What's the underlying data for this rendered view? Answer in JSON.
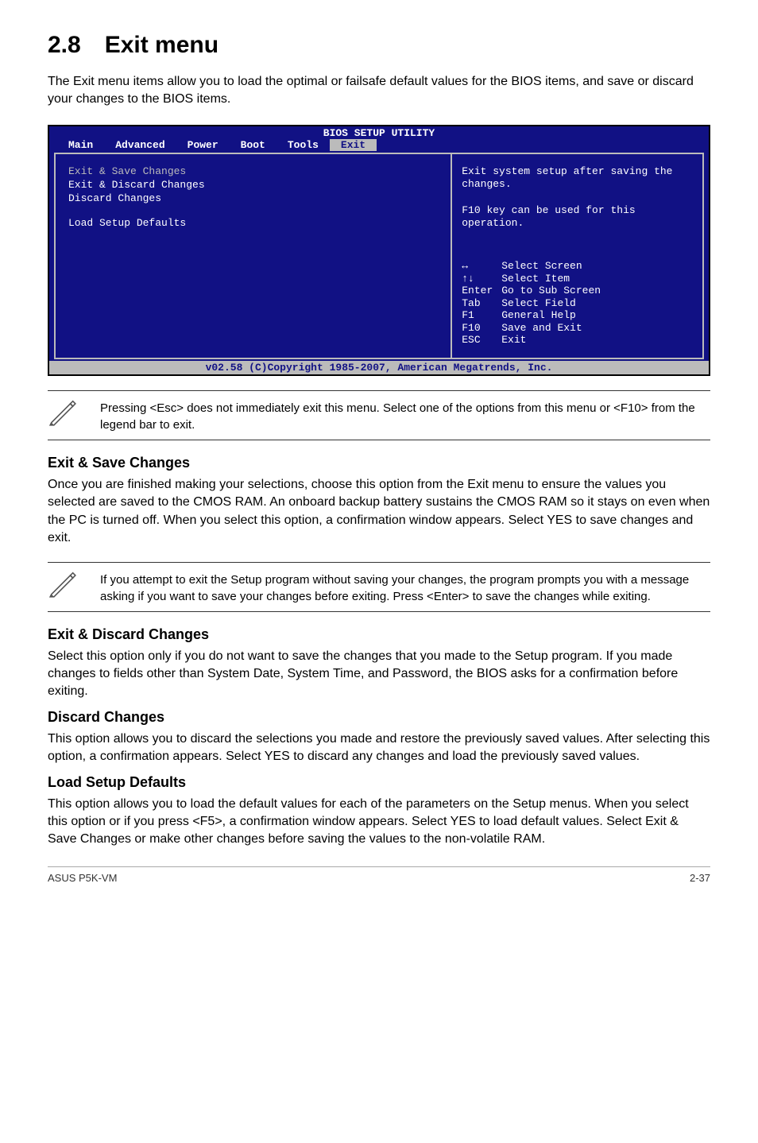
{
  "title": "2.8 Exit menu",
  "intro": "The Exit menu items allow you to load the optimal or failsafe default values for the BIOS items, and save or discard your changes to the BIOS items.",
  "bios": {
    "title": "BIOS SETUP UTILITY",
    "menus": [
      "Main",
      "Advanced",
      "Power",
      "Boot",
      "Tools",
      "Exit"
    ],
    "active_menu": "Exit",
    "left_items": [
      {
        "label": "Exit & Save Changes",
        "hl": true
      },
      {
        "label": "Exit & Discard Changes",
        "hl": false
      },
      {
        "label": "Discard Changes",
        "hl": false
      },
      {
        "label": "Load Setup Defaults",
        "hl": false,
        "gap_before": true
      }
    ],
    "help_top": "Exit system setup after saving the changes.\n\nF10 key can be used for this operation.",
    "nav": [
      {
        "key_glyph": "↔",
        "desc": "Select Screen",
        "special": true
      },
      {
        "key_glyph": "↑↓",
        "desc": "Select Item",
        "special": true
      },
      {
        "key": "Enter",
        "desc": "Go to Sub Screen"
      },
      {
        "key": "Tab",
        "desc": "Select Field"
      },
      {
        "key": "F1",
        "desc": "General Help"
      },
      {
        "key": "F10",
        "desc": "Save and Exit"
      },
      {
        "key": "ESC",
        "desc": "Exit"
      }
    ],
    "footer": "v02.58 (C)Copyright 1985-2007, American Megatrends, Inc."
  },
  "note1": "Pressing <Esc> does not immediately exit this menu. Select one of the options from this menu or <F10> from the legend bar to exit.",
  "sections": {
    "s1_title": "Exit & Save Changes",
    "s1_body": "Once you are finished making your selections, choose this option from the Exit menu to ensure the values you selected are saved to the CMOS RAM. An onboard backup battery sustains the CMOS RAM so it stays on even when the PC is turned off. When you select this option, a confirmation window appears. Select YES to save changes and exit.",
    "note2": " If you attempt to exit the Setup program without saving your changes, the program prompts you with a message asking if you want to save your changes before exiting. Press <Enter>  to save the  changes while exiting.",
    "s2_title": "Exit & Discard Changes",
    "s2_body": "Select this option only if you do not want to save the changes that you  made to the Setup program. If you made changes to fields other than System Date, System Time, and Password, the BIOS asks for a confirmation before exiting.",
    "s3_title": "Discard Changes",
    "s3_body": "This option allows you to discard the selections you made and restore the previously saved values. After selecting this option, a confirmation appears. Select YES to discard any changes and load the previously saved values.",
    "s4_title": "Load Setup Defaults",
    "s4_body": "This option allows you to load the default values for each of the parameters on the Setup menus. When you select this option or if you press <F5>, a confirmation window appears. Select YES to load default values. Select Exit & Save Changes or make other changes before saving the values to the non-volatile RAM."
  },
  "footer_left": "ASUS P5K-VM",
  "footer_right": "2-37"
}
